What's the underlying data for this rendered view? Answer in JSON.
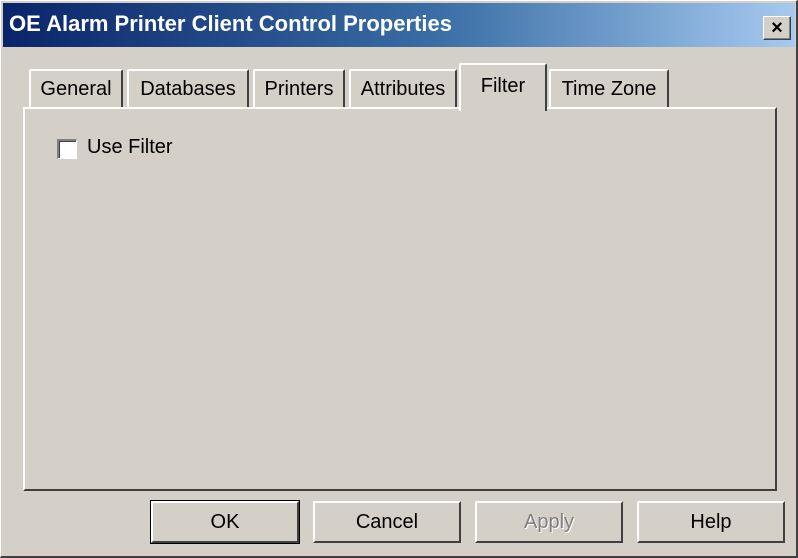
{
  "window": {
    "title": "OE Alarm Printer Client Control Properties",
    "close_symbol": "×"
  },
  "tabs": [
    {
      "label": "General",
      "active": false
    },
    {
      "label": "Databases",
      "active": false
    },
    {
      "label": "Printers",
      "active": false
    },
    {
      "label": "Attributes",
      "active": false
    },
    {
      "label": "Filter",
      "active": true
    },
    {
      "label": "Time Zone",
      "active": false
    }
  ],
  "filter_panel": {
    "use_filter_label": "Use Filter",
    "use_filter_checked": false
  },
  "buttons": {
    "ok": "OK",
    "cancel": "Cancel",
    "apply": "Apply",
    "help": "Help"
  },
  "colors": {
    "face": "#d4d0c8",
    "title_start": "#0a246a",
    "title_end": "#a6caf0"
  }
}
